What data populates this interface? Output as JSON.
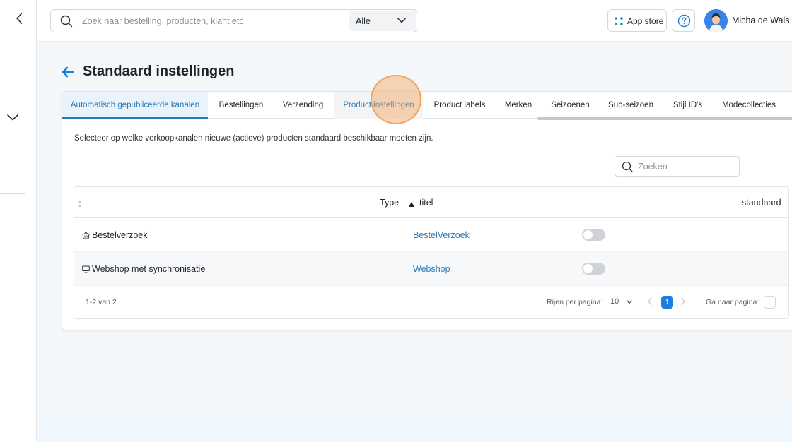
{
  "sidebar": {
    "back_icon": "chevron-left-icon",
    "collapse_icon": "chevron-down-icon"
  },
  "topbar": {
    "search": {
      "placeholder": "Zoek naar bestelling, producten, klant etc.",
      "value": "",
      "scope": "Alle"
    },
    "app_store_label": "App store",
    "help_icon": "question-icon",
    "user_name": "Micha de Wals"
  },
  "page": {
    "title": "Standaard instellingen",
    "tabs": [
      {
        "label": "Automatisch gepubliceerde kanalen",
        "active": true
      },
      {
        "label": "Bestellingen"
      },
      {
        "label": "Verzending"
      },
      {
        "label": "Product instellingen",
        "hover": true
      },
      {
        "label": "Product labels"
      },
      {
        "label": "Merken"
      },
      {
        "label": "Seizoenen"
      },
      {
        "label": "Sub-seizoen"
      },
      {
        "label": "Stijl ID's"
      },
      {
        "label": "Modecollecties"
      }
    ],
    "description": "Selecteer op welke verkoopkanalen nieuwe (actieve) producten standaard beschikbaar moeten zijn.",
    "filter": {
      "placeholder": "Zoeken",
      "value": ""
    },
    "table": {
      "columns": {
        "type": "Type",
        "title": "titel",
        "default": "standaard"
      },
      "rows": [
        {
          "name": "Bestelverzoek",
          "icon": "basket-icon",
          "link": "BestelVerzoek",
          "default": false
        },
        {
          "name": "Webshop met synchronisatie",
          "icon": "monitor-icon",
          "link": "Webshop",
          "default": false
        }
      ]
    },
    "pagination": {
      "range": "1-2 van 2",
      "rows_per_page_label": "Rijen per pagina:",
      "rows_per_page": "10",
      "current_page": "1",
      "goto_label": "Ga naar pagina:"
    }
  },
  "colors": {
    "accent": "#2a7ab8",
    "primary_button": "#1a7fe0",
    "click_highlight": "#f2a25a"
  }
}
